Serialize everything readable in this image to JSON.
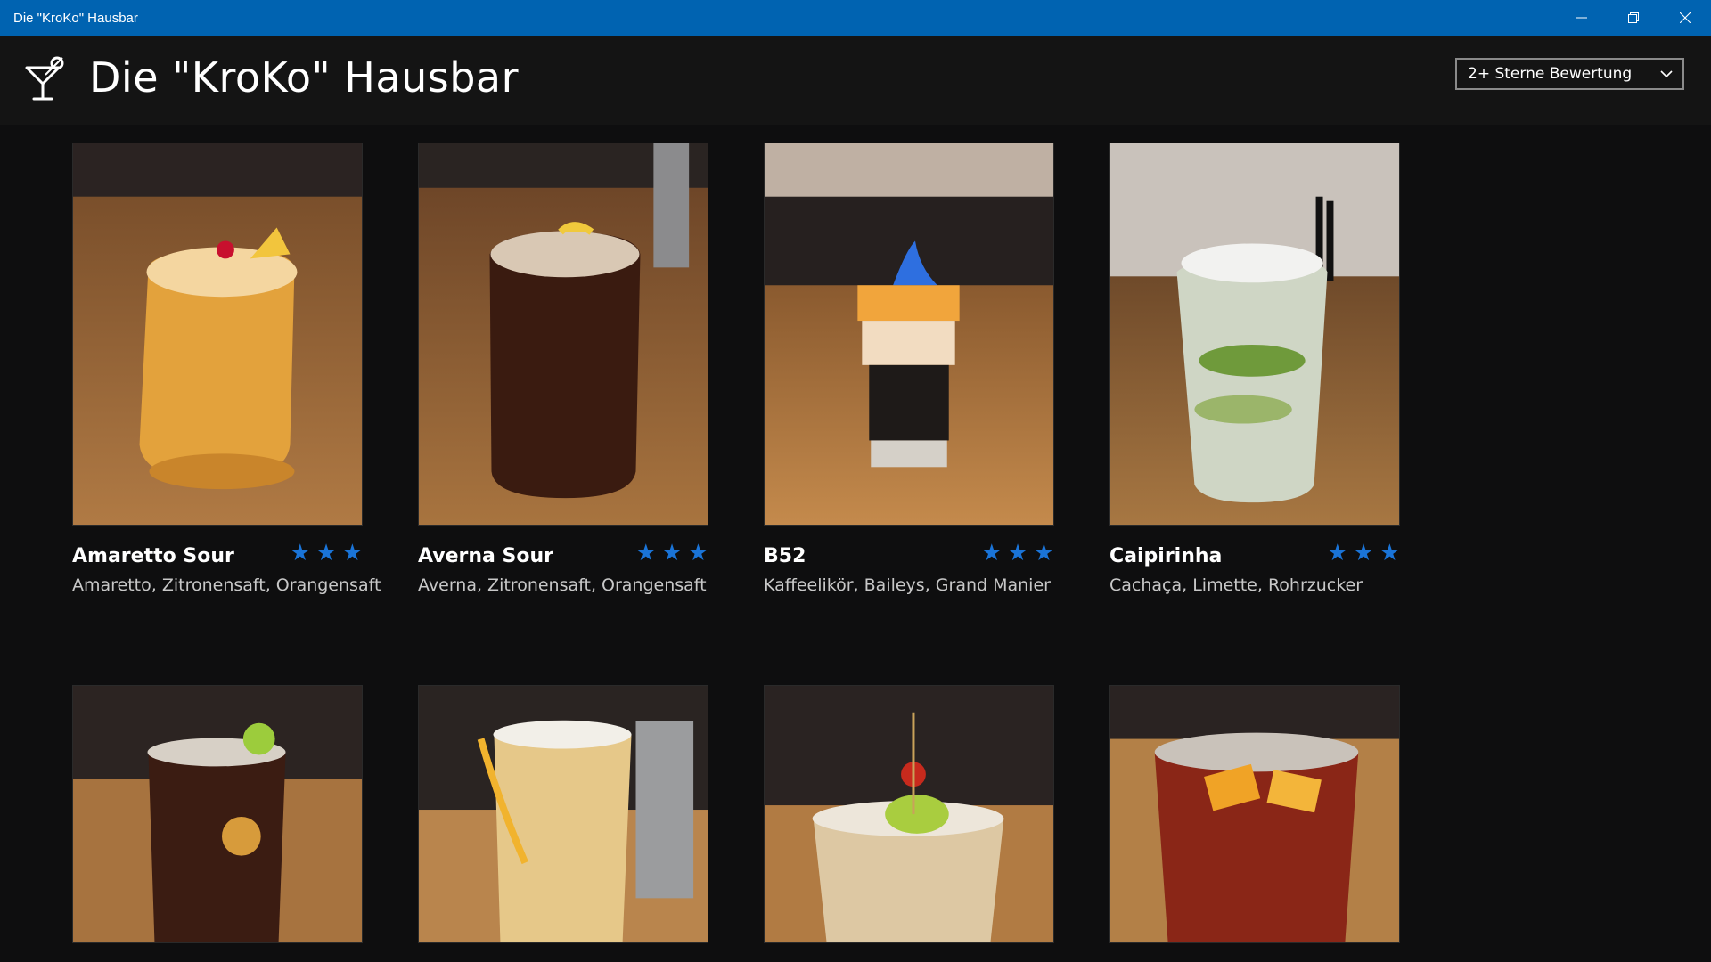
{
  "window": {
    "title": "Die \"KroKo\" Hausbar",
    "minimize_icon": "minimize-icon",
    "restore_icon": "restore-icon",
    "close_icon": "close-icon"
  },
  "header": {
    "title": "Die \"KroKo\" Hausbar",
    "logo_icon": "cocktail-glass-icon"
  },
  "filter": {
    "selected": "2+ Sterne Bewertung",
    "icon": "chevron-down-icon"
  },
  "colors": {
    "titlebar": "#0063b1",
    "background": "#0e0e0f",
    "header": "#141414",
    "star": "#1a74d8"
  },
  "cocktails": [
    {
      "name": "Amaretto Sour",
      "ingredients": "Amaretto, Zitronensaft, Orangensaft",
      "rating": 3
    },
    {
      "name": "Averna Sour",
      "ingredients": "Averna, Zitronensaft, Orangensaft",
      "rating": 3
    },
    {
      "name": "B52",
      "ingredients": "Kaffeelikör, Baileys, Grand Manier",
      "rating": 3
    },
    {
      "name": "Caipirinha",
      "ingredients": "Cachaça, Limette, Rohrzucker",
      "rating": 3
    }
  ]
}
